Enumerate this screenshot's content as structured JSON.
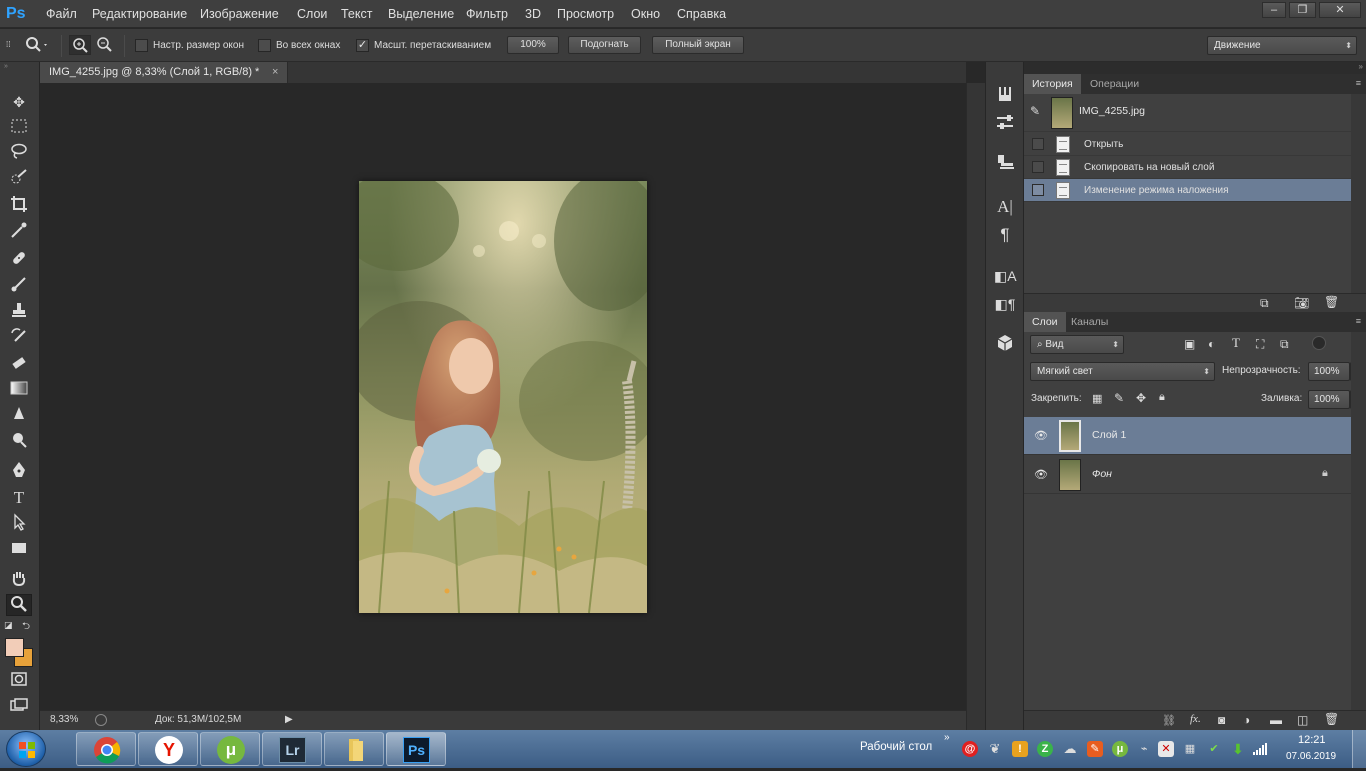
{
  "app": {
    "logo": "Ps",
    "menu": [
      "Файл",
      "Редактирование",
      "Изображение",
      "Слои",
      "Текст",
      "Выделение",
      "Фильтр",
      "3D",
      "Просмотр",
      "Окно",
      "Справка"
    ]
  },
  "options": {
    "resize_windows_label": "Настр. размер окон",
    "all_windows_label": "Во всех окнах",
    "scrubby_zoom_label": "Масшт. перетаскиванием",
    "zoom_100_label": "100%",
    "fit_label": "Подогнать",
    "fullscreen_label": "Полный экран",
    "workspace": "Движение"
  },
  "document": {
    "tab_title": "IMG_4255.jpg @ 8,33% (Слой 1, RGB/8) *",
    "zoom": "8,33%",
    "doc_info": "Док: 51,3M/102,5M"
  },
  "history_panel": {
    "tabs": [
      "История",
      "Операции"
    ],
    "snapshot_name": "IMG_4255.jpg",
    "items": [
      "Открыть",
      "Скопировать на новый слой",
      "Изменение режима наложения"
    ],
    "selected_index": 2
  },
  "layers_panel": {
    "tabs": [
      "Слои",
      "Каналы"
    ],
    "filter_label": "Вид",
    "blend_mode": "Мягкий свет",
    "opacity_label": "Непрозрачность:",
    "opacity_value": "100%",
    "lock_label": "Закрепить:",
    "fill_label": "Заливка:",
    "fill_value": "100%",
    "layers": [
      {
        "name": "Слой 1",
        "selected": true
      },
      {
        "name": "Фон",
        "selected": false,
        "locked": true
      }
    ]
  },
  "taskbar": {
    "desktop_label": "Рабочий стол",
    "time": "12:21",
    "date": "07.06.2019",
    "apps": [
      "chrome-icon",
      "yandex-icon",
      "utorrent-icon",
      "lightroom-icon",
      "folder-icon",
      "photoshop-icon"
    ],
    "lr_label": "Lr",
    "ps_label": "Ps",
    "yandex_label": "Y",
    "utorrent_label": "μ"
  },
  "colors": {
    "accent_selection": "#6b7d96",
    "foreground_swatch": "#f2cdb8",
    "background_swatch": "#e8a23a"
  }
}
